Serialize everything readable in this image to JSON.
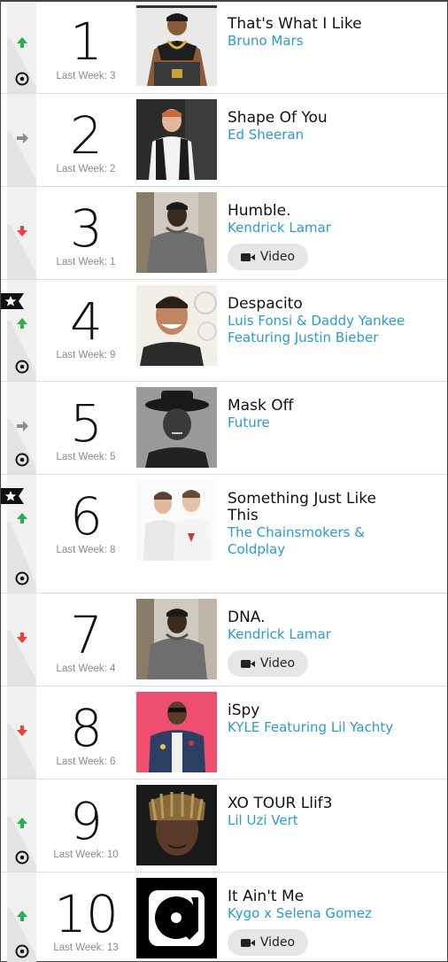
{
  "chart": {
    "entries": [
      {
        "rank": "1",
        "title": "That's What I Like",
        "artist_line1": "Bruno Mars",
        "artist_line2": "",
        "last_week": "Last Week: 3",
        "trend": "up",
        "new_peak": false,
        "has_video": false,
        "video_label": "",
        "art": "portrait-sitting-gold-chains"
      },
      {
        "rank": "2",
        "title": "Shape Of You",
        "artist_line1": "Ed Sheeran",
        "artist_line2": "",
        "last_week": "Last Week: 2",
        "trend": "same",
        "new_peak": false,
        "has_video": false,
        "video_label": "",
        "art": "portrait-standing-dark-room"
      },
      {
        "rank": "3",
        "title": "Humble.",
        "artist_line1": "Kendrick Lamar",
        "artist_line2": "",
        "last_week": "Last Week: 1",
        "trend": "down",
        "new_peak": false,
        "has_video": true,
        "video_label": "Video",
        "art": "portrait-grey-hoodie"
      },
      {
        "rank": "4",
        "title": "Despacito",
        "artist_line1": "Luis Fonsi & Daddy Yankee",
        "artist_line2": "Featuring Justin Bieber",
        "last_week": "Last Week: 9",
        "trend": "up",
        "new_peak": true,
        "has_video": false,
        "video_label": "",
        "art": "portrait-smiling-man"
      },
      {
        "rank": "5",
        "title": "Mask Off",
        "artist_line1": "Future",
        "artist_line2": "",
        "last_week": "Last Week: 5",
        "trend": "same",
        "new_peak": false,
        "has_video": false,
        "video_label": "",
        "art": "portrait-black-hat-bw"
      },
      {
        "rank": "6",
        "title": "Something Just Like This",
        "artist_line1": "The Chainsmokers &",
        "artist_line2": "Coldplay",
        "last_week": "Last Week: 8",
        "trend": "up",
        "new_peak": true,
        "has_video": false,
        "video_label": "",
        "art": "two-men-white-shirts"
      },
      {
        "rank": "7",
        "title": "DNA.",
        "artist_line1": "Kendrick Lamar",
        "artist_line2": "",
        "last_week": "Last Week: 4",
        "trend": "down",
        "new_peak": false,
        "has_video": true,
        "video_label": "Video",
        "art": "portrait-grey-hoodie"
      },
      {
        "rank": "8",
        "title": "iSpy",
        "artist_line1": "KYLE Featuring Lil Yachty",
        "artist_line2": "",
        "last_week": "Last Week: 6",
        "trend": "down",
        "new_peak": false,
        "has_video": false,
        "video_label": "",
        "art": "portrait-pink-background"
      },
      {
        "rank": "9",
        "title": "XO TOUR Llif3",
        "artist_line1": "Lil Uzi Vert",
        "artist_line2": "",
        "last_week": "Last Week: 10",
        "trend": "up",
        "new_peak": false,
        "has_video": false,
        "video_label": "",
        "art": "portrait-dreads-closeup"
      },
      {
        "rank": "10",
        "title": "It Ain't Me",
        "artist_line1": "Kygo x Selena Gomez",
        "artist_line2": "",
        "last_week": "Last Week: 13",
        "trend": "up",
        "new_peak": false,
        "has_video": true,
        "video_label": "Video",
        "art": "vinyl-record-icon"
      }
    ]
  },
  "colors": {
    "up": "#22b14c",
    "down": "#e8403a",
    "same": "#8c8c8c",
    "artist_link": "#2a9bd1",
    "video_button_bg": "#e6e6e6"
  }
}
